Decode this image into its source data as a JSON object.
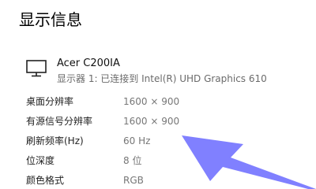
{
  "page": {
    "title": "显示信息"
  },
  "display": {
    "icon": "monitor-icon",
    "name": "Acer C200IA",
    "subtitle": "显示器 1: 已连接到 Intel(R) UHD Graphics 610"
  },
  "rows": [
    {
      "label": "桌面分辨率",
      "value": "1600 × 900"
    },
    {
      "label": "有源信号分辨率",
      "value": "1600 × 900"
    },
    {
      "label": "刷新频率(Hz)",
      "value": "60 Hz"
    },
    {
      "label": "位深度",
      "value": "8 位"
    },
    {
      "label": "颜色格式",
      "value": "RGB"
    }
  ],
  "annotation": {
    "arrow_color": "#8080ff"
  }
}
